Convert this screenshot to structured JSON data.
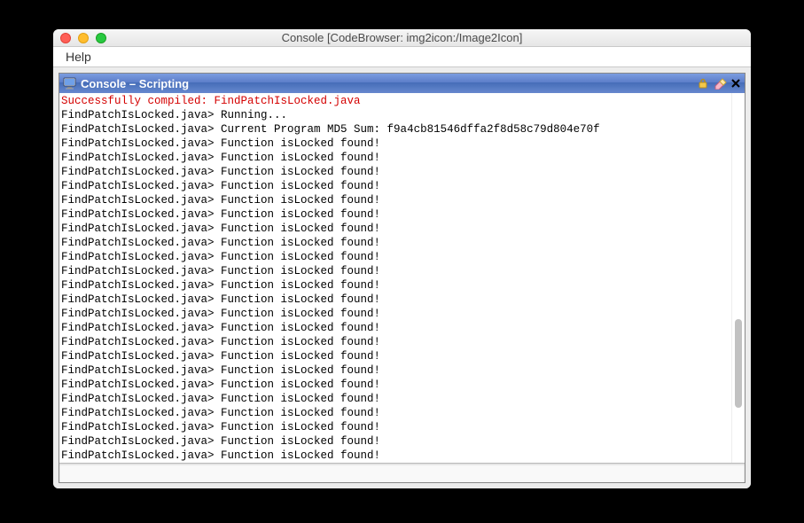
{
  "window": {
    "title": "Console [CodeBrowser: img2icon:/Image2Icon]"
  },
  "menubar": {
    "help": "Help"
  },
  "panel": {
    "title": "Console – Scripting"
  },
  "console": {
    "compiled_line": "Successfully compiled: FindPatchIsLocked.java",
    "script_prefix": "FindPatchIsLocked.java> ",
    "running_msg": "Running...",
    "md5_msg": "Current Program MD5 Sum: f9a4cb81546dffa2f8d58c79d804e70f",
    "found_msg": "Function isLocked found!",
    "found_msg_repeat_count": 23
  },
  "input": {
    "value": ""
  }
}
